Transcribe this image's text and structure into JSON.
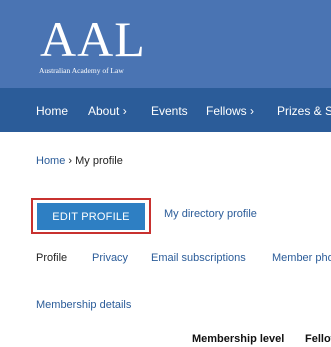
{
  "header": {
    "logo_text": "AAL",
    "logo_subtitle": "Australian Academy of Law"
  },
  "nav": {
    "items": [
      {
        "label": "Home"
      },
      {
        "label": "About ›"
      },
      {
        "label": "Events"
      },
      {
        "label": "Fellows ›"
      },
      {
        "label": "Prizes & Scholarships"
      }
    ]
  },
  "breadcrumb": {
    "home": "Home",
    "separator": "›",
    "current": "My profile"
  },
  "actions": {
    "edit_profile": "EDIT PROFILE",
    "directory_profile": "My directory profile"
  },
  "tabs": [
    {
      "label": "Profile"
    },
    {
      "label": "Privacy"
    },
    {
      "label": "Email subscriptions"
    },
    {
      "label": "Member photo"
    }
  ],
  "membership_details": "Membership details",
  "table": {
    "headers": [
      "Membership level",
      "Fellow"
    ]
  },
  "colors": {
    "header_bg": "#4a74b3",
    "nav_bg": "#2b5c99",
    "button_bg": "#2e7fc3",
    "highlight": "#c8312f",
    "link": "#2b5c99"
  }
}
